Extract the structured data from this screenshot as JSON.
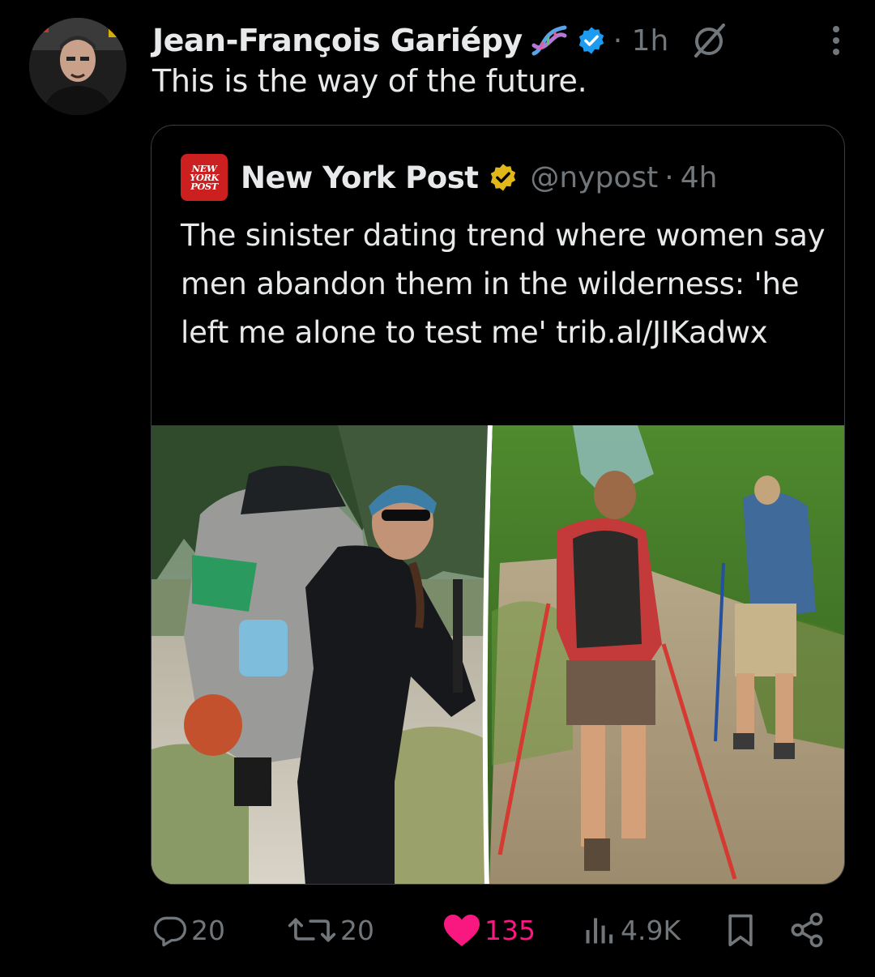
{
  "post": {
    "author_name": "Jean-François Gariépy",
    "time": "· 1h",
    "text": "This is the way of the future.",
    "icons": [
      "dna-emoji-icon",
      "verified-badge-icon",
      "grok-icon",
      "more-options-icon"
    ]
  },
  "quoted_post": {
    "logo_lines": [
      "NEW",
      "YORK",
      "POST"
    ],
    "name": "New York Post",
    "handle": "@nypost",
    "separator": "·",
    "time": "4h",
    "text": "The sinister dating trend where women say men abandon them in the wilderness: 'he left me alone to test me' trib.al/JIKadwx",
    "image": {
      "left": "woman hiking with large backpack and sunglasses",
      "right": "two hikers walking away on a forest trail"
    }
  },
  "actions": {
    "replies": "20",
    "reposts": "20",
    "likes": "135",
    "views": "4.9K"
  },
  "colors": {
    "background": "#000000",
    "text": "#e7e9ea",
    "muted": "#71767b",
    "verified_blue": "#1d9bf0",
    "verified_gold": "#e2b719",
    "like_pink": "#f91880",
    "nyp_red": "#cc1f1f"
  }
}
